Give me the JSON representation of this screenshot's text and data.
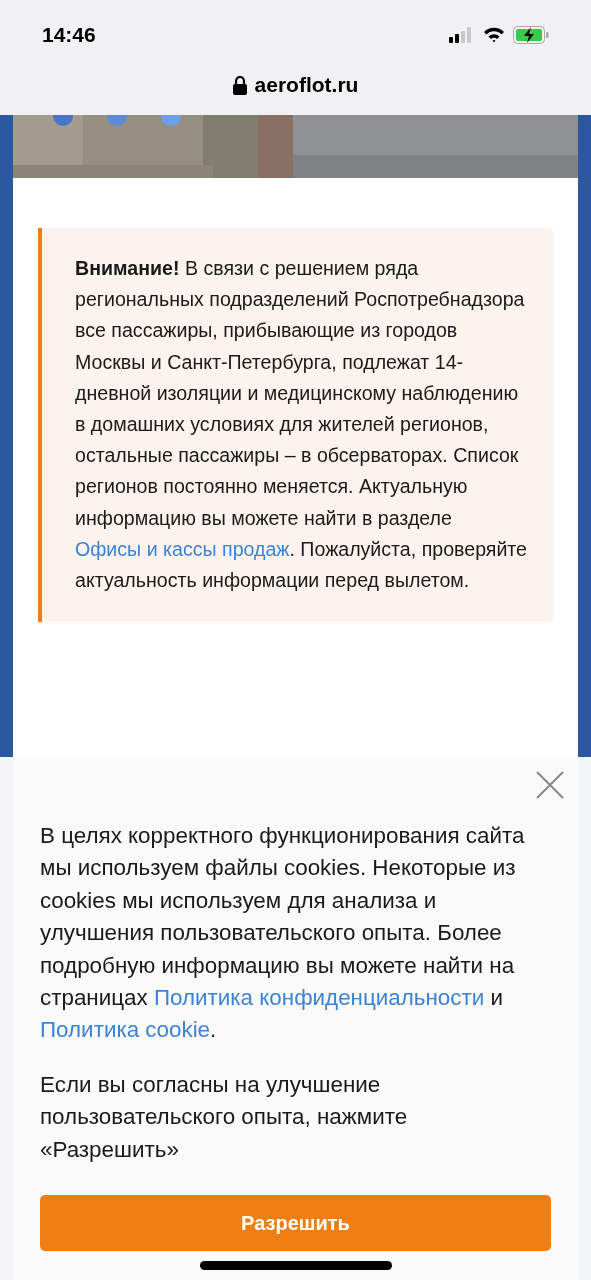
{
  "status_bar": {
    "time": "14:46"
  },
  "address_bar": {
    "url": "aeroflot.ru"
  },
  "notice": {
    "text_before": "**Внимание!** В связи с решением ряда региональных подразделений Роспотребнадзора все пассажиры, прибывающие из городов Москвы и Санкт-Петербурга, подлежат 14-дневной изоляции и медицинскому наблюдению в домашних условиях для жителей регионов, остальные пассажиры – в обсерваторах. Список регионов постоянно меняется. Актуальную информацию вы можете найти в разделе",
    "link_lines": [
      "Офисы и кассы",
      "продаж"
    ],
    "text_after": ". Пожалуйста, проверяйте актуальность информации перед вылетом."
  },
  "cookie_banner": {
    "text_before": "В целях корректного функционирования сайта мы используем файлы cookies. Некоторые из cookies мы используем для анализа и улучшения пользовательского опыта. Более подробную информацию вы можете найти на страницах",
    "privacy_link_lines": [
      "Политика",
      "конфиденциальности"
    ],
    "conjunction": "и",
    "cookie_link": "Политика cookie",
    "end": ".",
    "consent_text": "Если вы согласны на улучшение пользовательского опыта, нажмите «Разрешить»",
    "allow_button": "Разрешить"
  }
}
